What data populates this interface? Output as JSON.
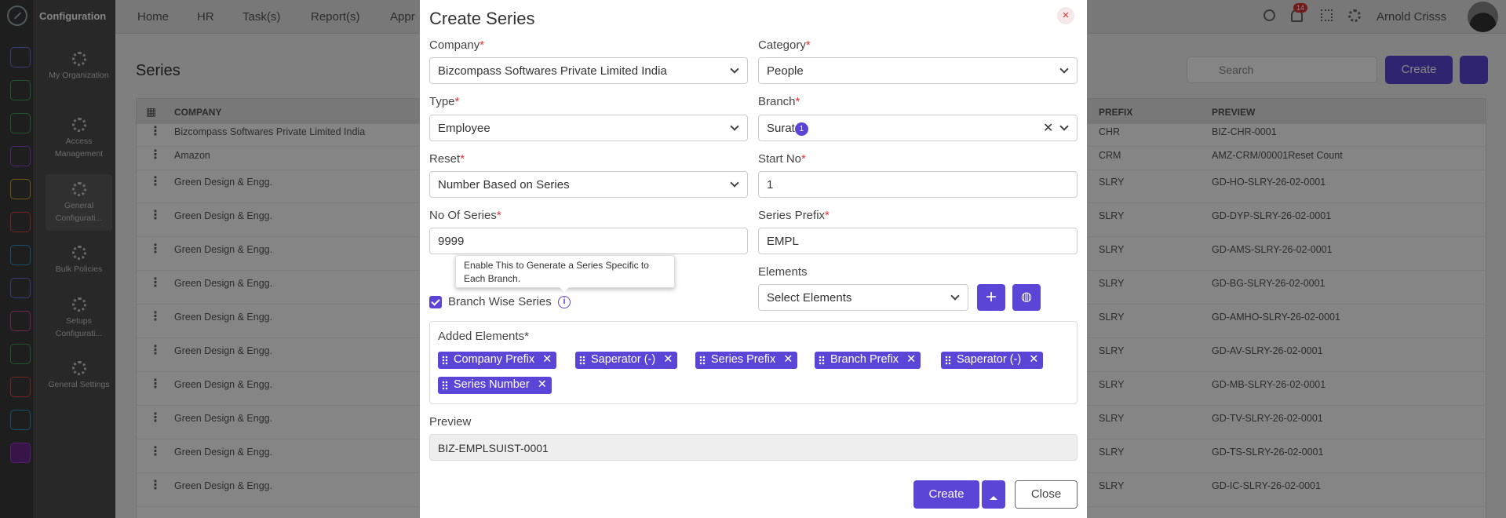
{
  "sidebar": {
    "title": "Configuration",
    "items": [
      {
        "label": "My Organization"
      },
      {
        "label": "Access Management"
      },
      {
        "label": "General Configurati..."
      },
      {
        "label": "Bulk Policies"
      },
      {
        "label": "Setups Configurati..."
      },
      {
        "label": "General Settings"
      }
    ]
  },
  "topnav": {
    "items": [
      "Home",
      "HR",
      "Task(s)",
      "Report(s)",
      "Appr"
    ],
    "notification_count": "14",
    "user_name": "Arnold Crisss"
  },
  "page": {
    "title": "Series",
    "search_placeholder": "Search",
    "create_label": "Create"
  },
  "table": {
    "columns": {
      "company": "COMPANY",
      "prefix": "PREFIX",
      "preview": "PREVIEW"
    },
    "rows": [
      {
        "company": "Bizcompass Softwares Private Limited India",
        "prefix": "CHR",
        "preview": "BIZ-CHR-0001"
      },
      {
        "company": "Amazon",
        "prefix": "CRM",
        "preview": "AMZ-CRM/00001Reset Count"
      },
      {
        "company": "Green Design & Engg.",
        "prefix": "SLRY",
        "preview": "GD-HO-SLRY-26-02-0001"
      },
      {
        "company": "Green Design & Engg.",
        "prefix": "SLRY",
        "preview": "GD-DYP-SLRY-26-02-0001"
      },
      {
        "company": "Green Design & Engg.",
        "prefix": "SLRY",
        "preview": "GD-AMS-SLRY-26-02-0001"
      },
      {
        "company": "Green Design & Engg.",
        "prefix": "SLRY",
        "preview": "GD-BG-SLRY-26-02-0001"
      },
      {
        "company": "Green Design & Engg.",
        "prefix": "SLRY",
        "preview": "GD-AMHO-SLRY-26-02-0001"
      },
      {
        "company": "Green Design & Engg.",
        "prefix": "SLRY",
        "preview": "GD-AV-SLRY-26-02-0001"
      },
      {
        "company": "Green Design & Engg.",
        "prefix": "SLRY",
        "preview": "GD-MB-SLRY-26-02-0001"
      },
      {
        "company": "Green Design & Engg.",
        "prefix": "SLRY",
        "preview": "GD-TV-SLRY-26-02-0001"
      },
      {
        "company": "Green Design & Engg.",
        "prefix": "SLRY",
        "preview": "GD-TS-SLRY-26-02-0001"
      },
      {
        "company": "Green Design & Engg.",
        "prefix": "SLRY",
        "preview": "GD-IC-SLRY-26-02-0001"
      }
    ]
  },
  "modal": {
    "title": "Create Series",
    "company_label": "Company",
    "company_value": "Bizcompass Softwares Private Limited India",
    "category_label": "Category",
    "category_value": "People",
    "type_label": "Type",
    "type_value": "Employee",
    "branch_label": "Branch",
    "branch_value": "Surat",
    "branch_count": "1",
    "reset_label": "Reset",
    "reset_value": "Number Based on Series",
    "start_no_label": "Start No",
    "start_no_value": "1",
    "no_of_series_label": "No Of Series",
    "no_of_series_value": "9999",
    "series_prefix_label": "Series Prefix",
    "series_prefix_value": "EMPL",
    "tooltip": "Enable This to Generate a Series Specific to Each Branch.",
    "branch_wise_label": "Branch Wise Series",
    "elements_label": "Elements",
    "elements_placeholder": "Select Elements",
    "added_elements_label": "Added Elements*",
    "chips": [
      "Company Prefix",
      "Saperator (-)",
      "Series Prefix",
      "Branch Prefix",
      "Saperator (-)",
      "Series Number"
    ],
    "preview_label": "Preview",
    "preview_value": "BIZ-EMPLSUIST-0001",
    "create_label": "Create",
    "close_label": "Close",
    "required_mark": "*"
  },
  "colors": {
    "accent": "#5b45d6",
    "danger": "#d33333"
  }
}
